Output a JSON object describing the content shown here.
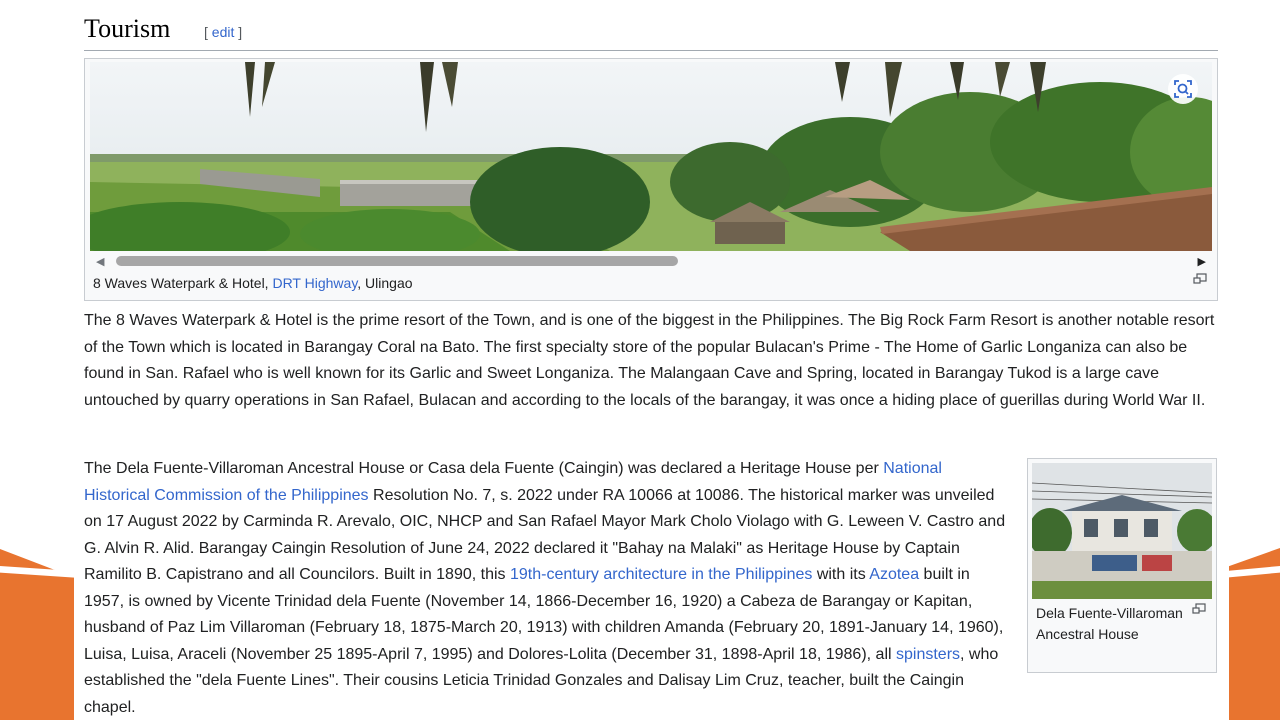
{
  "section": {
    "title": "Tourism",
    "edit_label": "edit"
  },
  "gallery": {
    "caption_prefix": "8 Waves Waterpark & Hotel, ",
    "caption_link": "DRT Highway",
    "caption_suffix": ", Ulingao"
  },
  "paragraph1": "The 8 Waves Waterpark & Hotel is the prime resort of the Town, and is one of the biggest in the Philippines. The Big Rock Farm Resort is another notable resort of the Town which is located in Barangay Coral na Bato. The first specialty store of the popular Bulacan's Prime - The Home of Garlic Longaniza can also be found in San. Rafael who is well known for its Garlic and Sweet Longaniza. The Malangaan Cave and Spring, located in Barangay Tukod is a large cave untouched by quarry operations in San Rafael, Bulacan and according to the locals of the barangay, it was once a hiding place of guerillas during World War II.",
  "paragraph2": {
    "t1": "The Dela Fuente-Villaroman Ancestral House or Casa dela Fuente (Caingin) was declared a Heritage House per ",
    "link1": "National Historical Commission of the Philippines",
    "t2": " Resolution No. 7, s. 2022 under RA 10066 at 10086. The historical marker was unveiled on 17 August 2022 by Carminda R. Arevalo, OIC, NHCP and San Rafael Mayor Mark Cholo Violago with G. Leween V. Castro and G. Alvin R. Alid. Barangay Caingin Resolution of June 24, 2022 declared it \"Bahay na Malaki\" as Heritage House by Captain Ramilito B. Capistrano and all Councilors. Built in 1890, this ",
    "link2": "19th-century architecture in the Philippines",
    "t3": " with its ",
    "link3": "Azotea",
    "t4": " built in 1957, is owned by Vicente Trinidad dela Fuente (November 14, 1866-December 16, 1920) a Cabeza de Barangay or Kapitan, husband of Paz Lim Villaroman (February 18, 1875-March 20, 1913) with children Amanda (February 20, 1891-January 14, 1960), Luisa, Luisa, Araceli (November 25 1895-April 7, 1995) and Dolores-Lolita (December 31, 1898-April 18, 1986), all ",
    "link4": "spinsters",
    "t5": ", who established the \"dela Fuente Lines\". Their cousins Leticia Trinidad Gonzales and Dalisay Lim Cruz, teacher, built the Caingin chapel."
  },
  "thumbnail": {
    "caption": "Dela Fuente-Villaroman Ancestral House"
  },
  "colors": {
    "link": "#3366cc",
    "accent_band": "#e8742f"
  },
  "icons": [
    "zoom-icon",
    "scroll-left-arrow-icon",
    "scroll-right-arrow-icon",
    "expand-icon"
  ]
}
